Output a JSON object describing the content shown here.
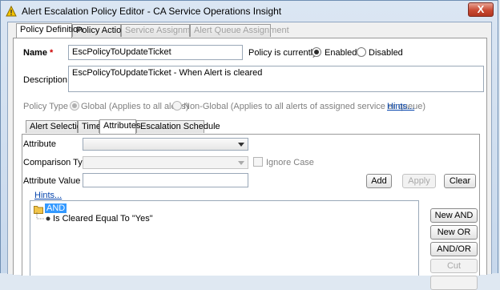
{
  "window": {
    "title": "Alert Escalation Policy Editor - CA Service Operations Insight",
    "close_label": "X",
    "icon": "warning-bell-icon"
  },
  "main_tabs": [
    {
      "label": "Policy Definition",
      "active": true,
      "enabled": true
    },
    {
      "label": "Policy Actions",
      "active": false,
      "enabled": true
    },
    {
      "label": "Service Assignment",
      "active": false,
      "enabled": false
    },
    {
      "label": "Alert Queue Assignment",
      "active": false,
      "enabled": false
    }
  ],
  "policy": {
    "name_label": "Name",
    "required_mark": "*",
    "name_value": "EscPolicyToUpdateTicket",
    "status_label": "Policy is currently",
    "enabled_label": "Enabled",
    "disabled_label": "Disabled",
    "status_selected": "Enabled",
    "description_label": "Description",
    "description_value": "EscPolicyToUpdateTicket - When Alert is cleared",
    "type_label": "Policy Type",
    "global_label": "Global (Applies to all alerts)",
    "nonglobal_label": "Non-Global (Applies to all alerts of assigned service or queue)",
    "type_selected": "Global",
    "hints_link": "Hints..."
  },
  "sub_tabs": [
    {
      "label": "Alert Selection",
      "active": false
    },
    {
      "label": "Time",
      "active": false
    },
    {
      "label": "Attributes",
      "active": true
    },
    {
      "label": "Escalation Schedule",
      "active": false
    }
  ],
  "attributes": {
    "attribute_label": "Attribute",
    "attribute_value": "",
    "comparison_label": "Comparison Type",
    "comparison_value": "",
    "ignore_case_label": "Ignore Case",
    "ignore_case_checked": false,
    "value_label": "Attribute Value",
    "value_input": "",
    "add_label": "Add",
    "apply_label": "Apply",
    "clear_label": "Clear",
    "hints_link": "Hints...",
    "tree_root": "AND",
    "tree_child": "Is Cleared Equal To \"Yes\"",
    "side_buttons": {
      "new_and": "New AND",
      "new_or": "New OR",
      "and_or": "AND/OR",
      "cut": "Cut"
    }
  }
}
